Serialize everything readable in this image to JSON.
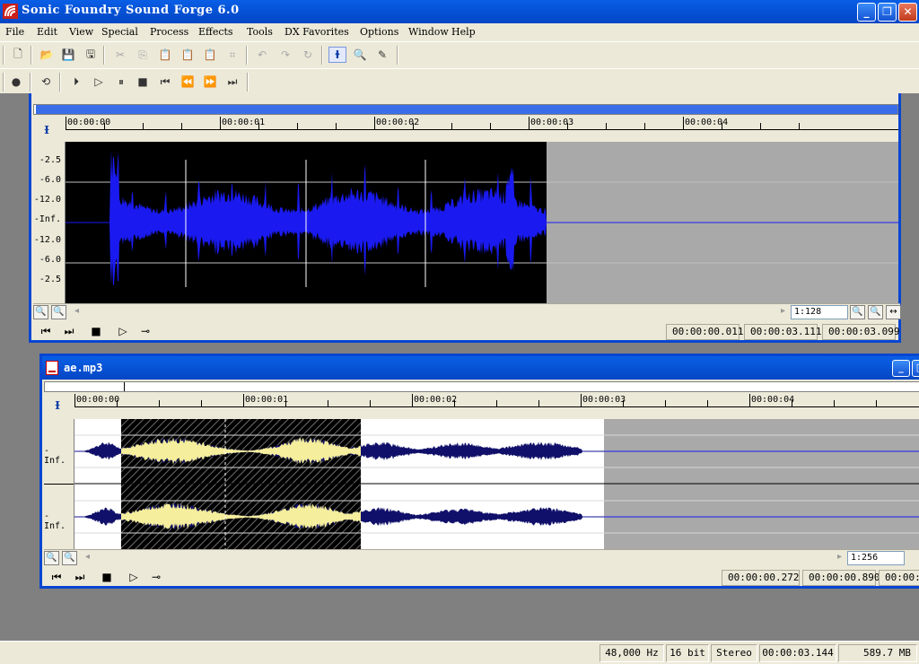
{
  "app": {
    "title": "Sonic Foundry Sound Forge 6.0",
    "icon": "sound-forge-logo-icon"
  },
  "window_controls": {
    "minimize": "_",
    "restore": "❐",
    "close": "✕"
  },
  "menu": [
    "File",
    "Edit",
    "View",
    "Special",
    "Process",
    "Effects",
    "Tools",
    "DX Favorites",
    "Options",
    "Window",
    "Help"
  ],
  "toolbar1": {
    "icons": [
      "new-file-icon",
      "open-folder-icon",
      "save-icon",
      "save-all-icon",
      "cut-icon",
      "copy-icon",
      "paste-icon",
      "paste-mix-icon",
      "paste-crossfade-icon",
      "trim-crop-icon",
      "undo-icon",
      "redo-icon",
      "repeat-icon",
      "edit-tool-icon",
      "magnify-tool-icon",
      "pencil-tool-icon"
    ]
  },
  "toolbar2": {
    "icons": [
      "record-icon",
      "loop-playback-icon",
      "play-all-icon",
      "play-icon",
      "pause-icon",
      "stop-icon",
      "go-to-start-icon",
      "rewind-icon",
      "fast-forward-icon",
      "go-to-end-icon"
    ]
  },
  "window1": {
    "title": "",
    "ruler": [
      "00:00:00",
      "00:00:01",
      "00:00:02",
      "00:00:03",
      "00:00:04"
    ],
    "scale": [
      "-2.5",
      "-6.0",
      "-12.0",
      "-Inf.",
      "-12.0",
      "-6.0",
      "-2.5"
    ],
    "zoom": "1:128",
    "times": [
      "00:00:00.011",
      "00:00:03.111",
      "00:00:03.099"
    ],
    "colors": {
      "wave_bg": "#000000",
      "wave": "#1a1af0",
      "empty": "#a9a9a9"
    }
  },
  "window2": {
    "title": "ae.mp3",
    "ruler": [
      "00:00:00",
      "00:00:01",
      "00:00:02",
      "00:00:03",
      "00:00:04"
    ],
    "channel_scale": [
      "-Inf.",
      "-Inf."
    ],
    "zoom": "1:256",
    "times": [
      "00:00:00.272",
      "00:00:00.890",
      "00:00:0"
    ],
    "colors": {
      "wave_bg": "#ffffff",
      "wave": "#10106a",
      "selection": "#000000",
      "selection_wave": "#f5ee9c"
    }
  },
  "status": {
    "sample_rate": "48,000 Hz",
    "bit_depth": "16 bit",
    "channels": "Stereo",
    "length": "00:00:03.144",
    "free_space": "589.7 MB"
  }
}
